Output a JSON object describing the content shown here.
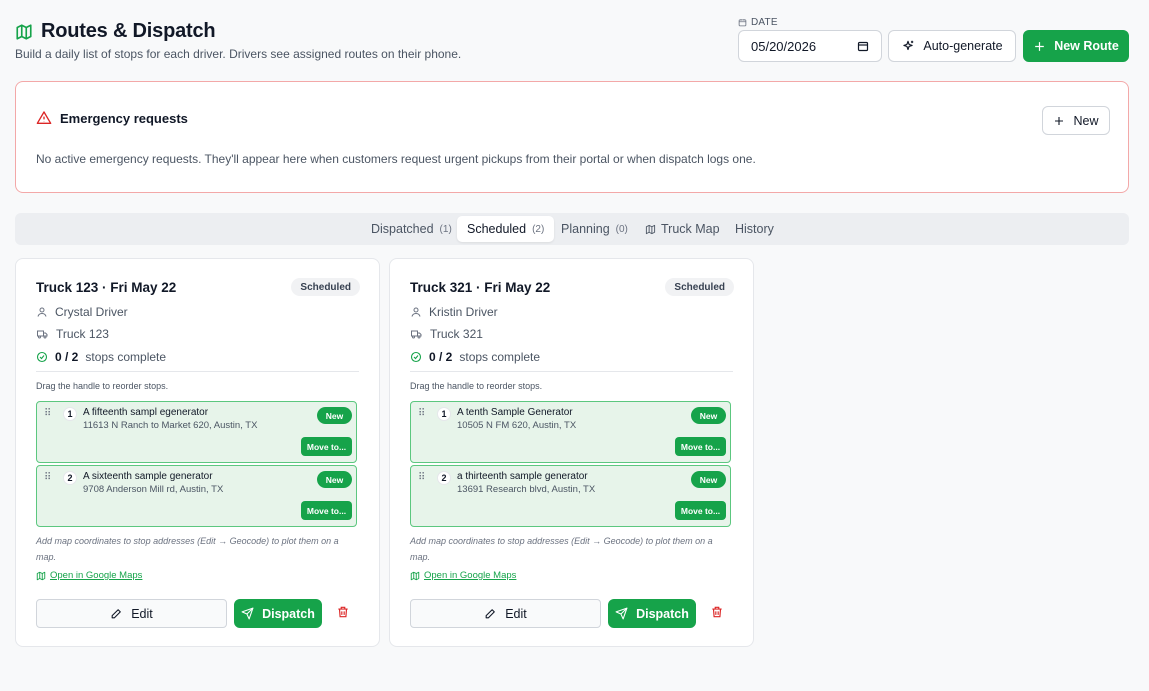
{
  "header": {
    "title": "Routes & Dispatch",
    "subtitle": "Build a daily list of stops for each driver. Drivers see assigned routes on their phone.",
    "date_label": "DATE",
    "date_value": "05/20/2026",
    "autogen_label": "Auto-generate",
    "new_route_label": "New Route"
  },
  "emergency": {
    "title": "Emergency requests",
    "new_label": "New",
    "message": "No active emergency requests. They'll appear here when customers request urgent pickups from their portal or when dispatch logs one."
  },
  "tabs": [
    {
      "label": "Dispatched",
      "count": "(1)"
    },
    {
      "label": "Scheduled",
      "count": "(2)"
    },
    {
      "label": "Planning",
      "count": "(0)"
    },
    {
      "label": "Truck Map",
      "count": ""
    },
    {
      "label": "History",
      "count": ""
    }
  ],
  "active_tab": "Scheduled",
  "routes": [
    {
      "title": "Truck 123 · Fri May 22",
      "status": "Scheduled",
      "driver": "Crystal Driver",
      "truck": "Truck 123",
      "progress": "0 / 2",
      "progress_suffix": "stops complete",
      "hint": "Drag the handle to reorder stops.",
      "stops": [
        {
          "num": "1",
          "name": "A fifteenth sampl egenerator",
          "address": "11613 N Ranch to Market 620, Austin, TX",
          "badge": "New",
          "move": "Move to..."
        },
        {
          "num": "2",
          "name": "A sixteenth sample generator",
          "address": "9708 Anderson Mill rd, Austin, TX",
          "badge": "New",
          "move": "Move to..."
        }
      ],
      "note": "Add map coordinates to stop addresses (Edit → Geocode) to plot them on a map.",
      "maps_link": "Open in Google Maps",
      "edit_label": "Edit",
      "dispatch_label": "Dispatch"
    },
    {
      "title": "Truck 321 · Fri May 22",
      "status": "Scheduled",
      "driver": "Kristin Driver",
      "truck": "Truck 321",
      "progress": "0 / 2",
      "progress_suffix": "stops complete",
      "hint": "Drag the handle to reorder stops.",
      "stops": [
        {
          "num": "1",
          "name": "A tenth Sample Generator",
          "address": "10505 N FM 620, Austin, TX",
          "badge": "New",
          "move": "Move to..."
        },
        {
          "num": "2",
          "name": "a thirteenth sample generator",
          "address": "13691 Research blvd, Austin, TX",
          "badge": "New",
          "move": "Move to..."
        }
      ],
      "note": "Add map coordinates to stop addresses (Edit → Geocode) to plot them on a map.",
      "maps_link": "Open in Google Maps",
      "edit_label": "Edit",
      "dispatch_label": "Dispatch"
    }
  ],
  "colors": {
    "accent": "#16a34a",
    "danger": "#dc2626",
    "stop_bg": "#e7f4ea",
    "stop_border": "#5cc77f"
  }
}
